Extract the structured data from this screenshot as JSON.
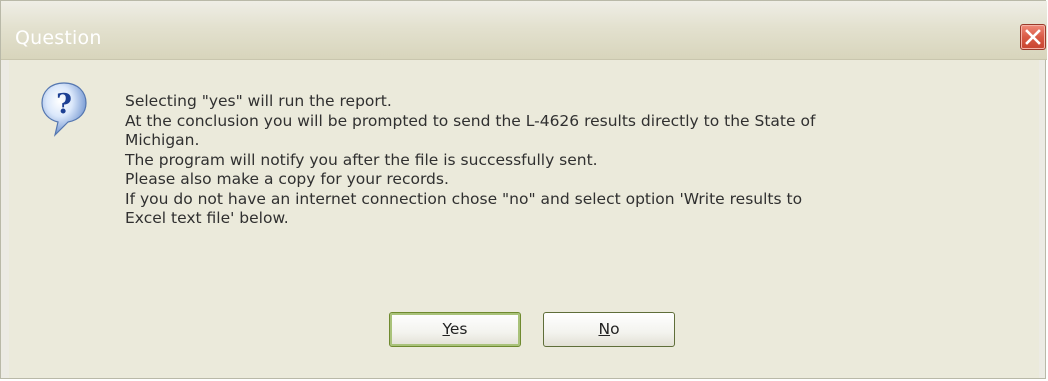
{
  "dialog": {
    "title": "Question",
    "close_icon": "close-icon",
    "icon": "question-icon",
    "message_lines": [
      "Selecting \"yes\" will run the report.",
      "At the conclusion you will be prompted to send the L-4626 results directly to the State of",
      "Michigan.",
      "The program will notify you after the file is successfully sent.",
      "Please also make a copy for your records.",
      "If you do not have an internet connection chose \"no\" and select option 'Write results to",
      "Excel text file' below."
    ],
    "buttons": {
      "yes_mnemonic": "Y",
      "yes_rest": "es",
      "no_mnemonic": "N",
      "no_rest": "o"
    }
  },
  "colors": {
    "titlebar": "#dcdac4",
    "body": "#ebeadb",
    "close": "#d95a45"
  }
}
